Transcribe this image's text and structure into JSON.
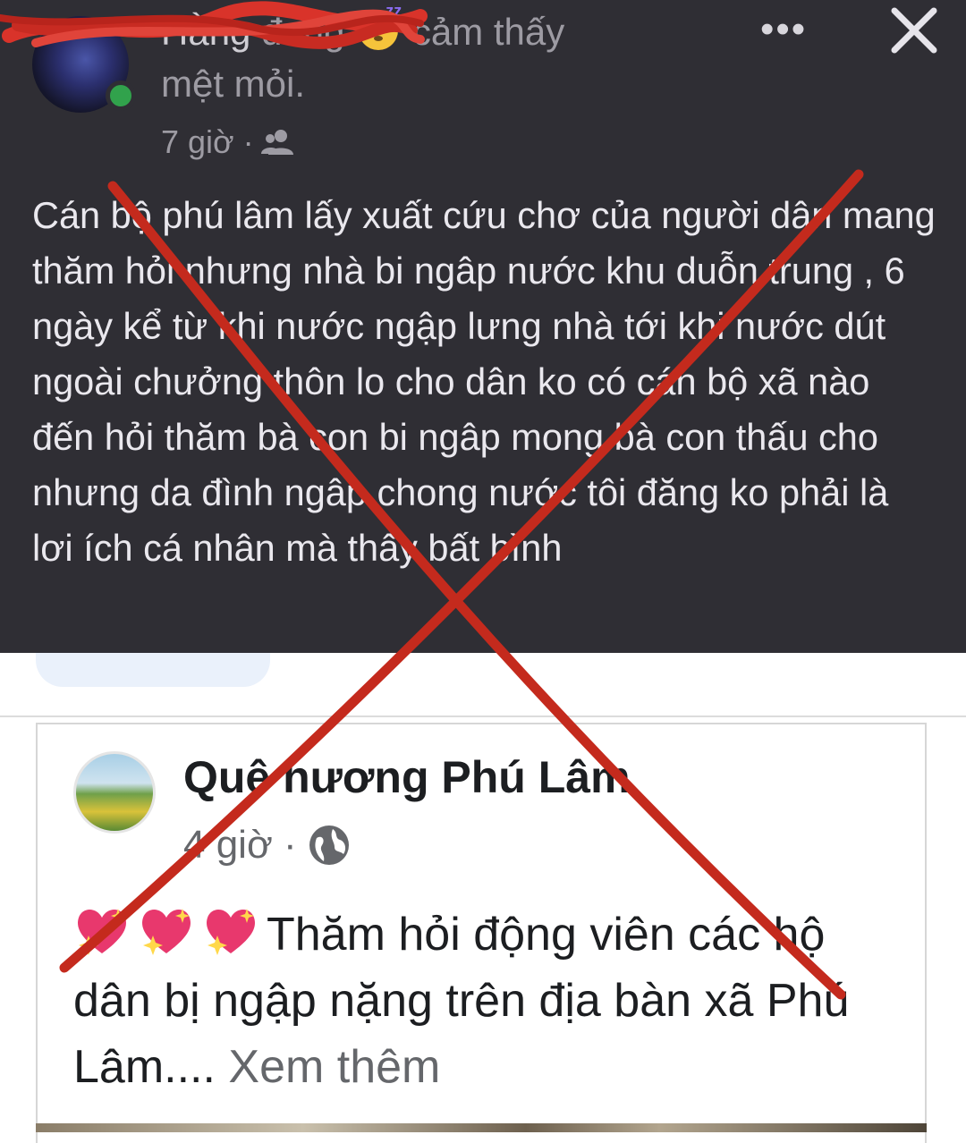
{
  "top_post": {
    "author_name": "Hằng",
    "status_prefix": "đang",
    "status_feeling": "cảm thấy",
    "status_line2": "mệt mỏi.",
    "time": "7 giờ ·",
    "more_label": "•••",
    "body": "Cán bộ phú lâm lấy xuất cứu chơ của người dân mang thăm hỏi nhưng nhà bi ngâp nước khu duỗn trung , 6 ngày kể từ khi nước ngập lưng nhà tới khi nước dút ngoài chưởng thôn lo cho dân ko có cán bộ xã nào đến hỏi thăm bà con bi ngâp   mong bà con thấu cho nhưng da đình ngâp chong nước tôi đăng ko phải là lơi ích cá nhân mà thấy bất bình"
  },
  "shared_post": {
    "page_name": "Quê hương Phú Lâm",
    "time": "4 giờ ·",
    "body_start": "Thăm hỏi động  viên các hộ dân bị ngập nặng trên địa bàn xã Phú Lâm....",
    "see_more": "Xem thêm"
  },
  "icons": {
    "friends": "friends-audience-icon",
    "globe": "globe-public-icon",
    "close": "close-icon",
    "feeling": "sleepy-face-emoji",
    "hearts": "sparkling-heart-emoji"
  },
  "colors": {
    "dark_bg": "#2f2e34",
    "online": "#31a24c",
    "cross": "#c42a1d",
    "redaction": "#d9332a"
  }
}
